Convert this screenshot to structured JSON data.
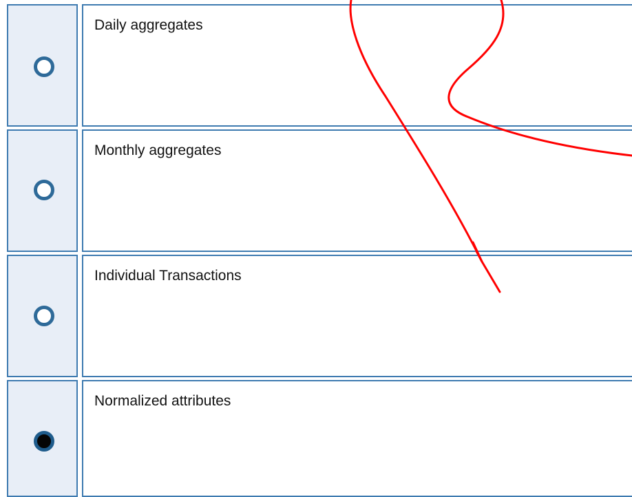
{
  "options": [
    {
      "label": "Daily aggregates",
      "checked": false
    },
    {
      "label": "Monthly aggregates",
      "checked": false
    },
    {
      "label": "Individual Transactions",
      "checked": false
    },
    {
      "label": "Normalized attributes",
      "checked": true
    }
  ],
  "colors": {
    "border": "#3d7ab0",
    "radio_cell_bg": "#e8eef7",
    "radio_ring": "#2e6a99",
    "annotation_stroke": "#ff0000"
  }
}
